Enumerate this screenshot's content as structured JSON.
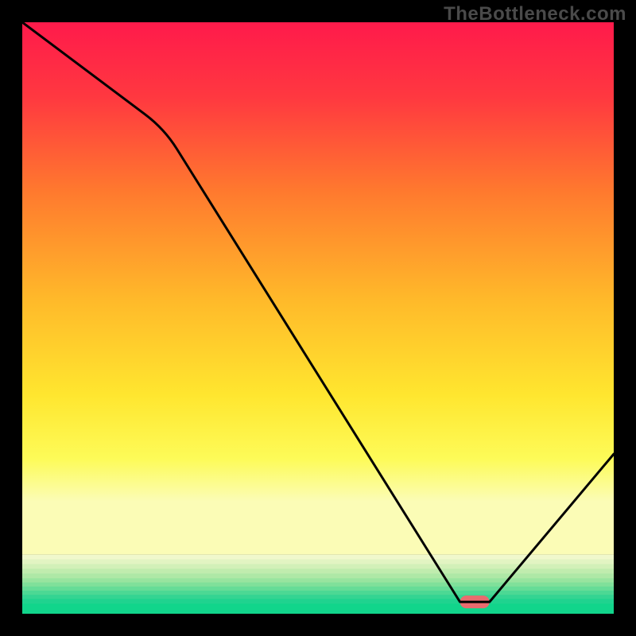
{
  "watermark": "TheBottleneck.com",
  "chart_data": {
    "type": "line",
    "title": "",
    "xlabel": "",
    "ylabel": "",
    "xlim": [
      0,
      100
    ],
    "ylim": [
      0,
      100
    ],
    "x": [
      0,
      24,
      74,
      79,
      100
    ],
    "values": [
      100,
      82,
      2,
      2,
      27
    ],
    "marker": {
      "x_start": 74,
      "x_end": 79,
      "y": 2,
      "color": "#ea6b6e"
    },
    "gradient_stops": [
      {
        "pct": 0,
        "color": "#ff1a4b"
      },
      {
        "pct": 14,
        "color": "#ff3840"
      },
      {
        "pct": 32,
        "color": "#ff7a2e"
      },
      {
        "pct": 52,
        "color": "#ffb92a"
      },
      {
        "pct": 70,
        "color": "#ffe62f"
      },
      {
        "pct": 82,
        "color": "#fdfb58"
      },
      {
        "pct": 90,
        "color": "#fbfcb6"
      }
    ],
    "bottom_bands": [
      {
        "y_from": 90.0,
        "y_to": 90.8,
        "color": "#f0f8cc"
      },
      {
        "y_from": 90.8,
        "y_to": 91.6,
        "color": "#e2f4c2"
      },
      {
        "y_from": 91.6,
        "y_to": 92.4,
        "color": "#d2f0b8"
      },
      {
        "y_from": 92.4,
        "y_to": 93.2,
        "color": "#c0ecae"
      },
      {
        "y_from": 93.2,
        "y_to": 94.0,
        "color": "#aee8a6"
      },
      {
        "y_from": 94.0,
        "y_to": 94.7,
        "color": "#98e49f"
      },
      {
        "y_from": 94.7,
        "y_to": 95.4,
        "color": "#80e09a"
      },
      {
        "y_from": 95.4,
        "y_to": 96.1,
        "color": "#66dc97"
      },
      {
        "y_from": 96.1,
        "y_to": 96.8,
        "color": "#4cd894"
      },
      {
        "y_from": 96.8,
        "y_to": 97.5,
        "color": "#34d492"
      },
      {
        "y_from": 97.5,
        "y_to": 98.3,
        "color": "#1fd38f"
      },
      {
        "y_from": 98.3,
        "y_to": 100,
        "color": "#11d58b"
      }
    ],
    "curve_color": "#000000",
    "curve_width": 3
  }
}
